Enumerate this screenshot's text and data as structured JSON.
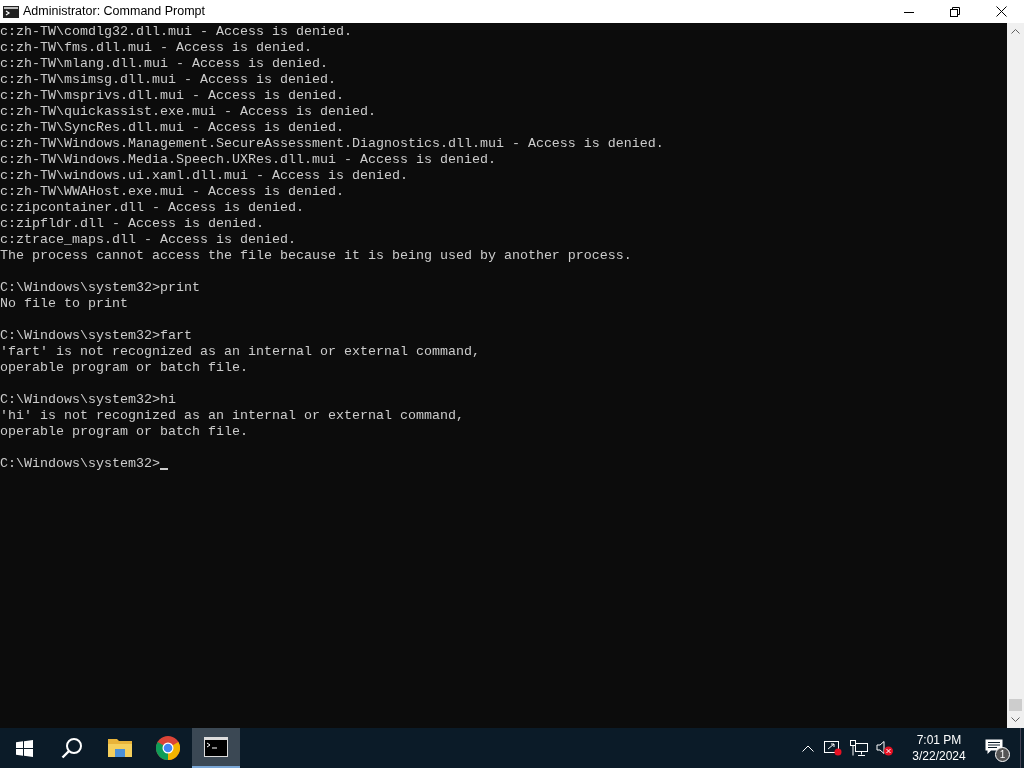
{
  "window": {
    "title": "Administrator: Command Prompt"
  },
  "console": {
    "blocks": [
      [
        "c:zh-TW\\comdlg32.dll.mui - Access is denied.",
        "c:zh-TW\\fms.dll.mui - Access is denied.",
        "c:zh-TW\\mlang.dll.mui - Access is denied.",
        "c:zh-TW\\msimsg.dll.mui - Access is denied.",
        "c:zh-TW\\msprivs.dll.mui - Access is denied.",
        "c:zh-TW\\quickassist.exe.mui - Access is denied.",
        "c:zh-TW\\SyncRes.dll.mui - Access is denied.",
        "c:zh-TW\\Windows.Management.SecureAssessment.Diagnostics.dll.mui - Access is denied.",
        "c:zh-TW\\Windows.Media.Speech.UXRes.dll.mui - Access is denied.",
        "c:zh-TW\\windows.ui.xaml.dll.mui - Access is denied.",
        "c:zh-TW\\WWAHost.exe.mui - Access is denied.",
        "c:zipcontainer.dll - Access is denied.",
        "c:zipfldr.dll - Access is denied.",
        "c:ztrace_maps.dll - Access is denied.",
        "The process cannot access the file because it is being used by another process."
      ],
      [
        "C:\\Windows\\system32>print",
        "No file to print"
      ],
      [
        "C:\\Windows\\system32>fart",
        "'fart' is not recognized as an internal or external command,",
        "operable program or batch file."
      ],
      [
        "C:\\Windows\\system32>hi",
        "'hi' is not recognized as an internal or external command,",
        "operable program or batch file."
      ]
    ],
    "prompt": {
      "text": "C:\\Windows\\system32>",
      "cursor": true
    }
  },
  "taskbar": {
    "apps": [
      {
        "kind": "start",
        "selected": false
      },
      {
        "kind": "search",
        "selected": false
      },
      {
        "kind": "folder",
        "selected": false
      },
      {
        "kind": "browser",
        "selected": false
      },
      {
        "kind": "terminal",
        "selected": true
      }
    ],
    "time": "7:01 PM",
    "date": "3/22/2024",
    "notifications": "1"
  }
}
